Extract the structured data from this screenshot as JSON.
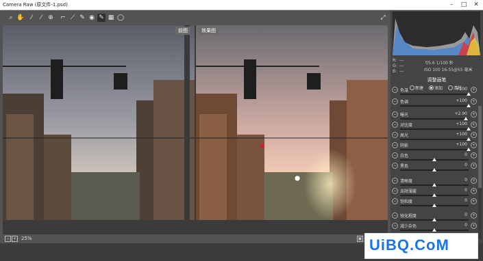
{
  "window": {
    "title": "Camera Raw (原文件-1.psd)"
  },
  "toolbar": {
    "tools": [
      "zoom-icon",
      "hand-icon",
      "white-balance-icon",
      "color-sampler-icon",
      "targeted-adjust-icon",
      "crop-icon",
      "straighten-icon",
      "spot-removal-icon",
      "red-eye-icon",
      "adjustment-brush-icon",
      "graduated-filter-icon",
      "radial-filter-icon"
    ],
    "fullscreen_icon": "fullscreen-icon"
  },
  "preview": {
    "before_label": "前图",
    "after_label": "效果图"
  },
  "bottombar": {
    "zoom": "25%"
  },
  "histogram": {
    "r_label": "R:",
    "g_label": "G:",
    "b_label": "B:",
    "r_value": "---",
    "g_value": "---",
    "b_value": "---",
    "aperture_shutter": "f/5.6   1/100 秒",
    "iso_lens": "ISO 100   16-55@55 毫米"
  },
  "panel": {
    "title": "调整画笔",
    "modes": [
      "新建",
      "添加",
      "清除"
    ],
    "active_mode": "添加",
    "sliders": [
      {
        "label": "色温",
        "value": "+100"
      },
      {
        "label": "色调",
        "value": "+100"
      },
      {
        "label": "曝光",
        "value": "+2.90"
      },
      {
        "label": "对比度",
        "value": "+100"
      },
      {
        "label": "高光",
        "value": "+100"
      },
      {
        "label": "阴影",
        "value": "+100"
      },
      {
        "label": "白色",
        "value": "0"
      },
      {
        "label": "黑色",
        "value": "0"
      },
      {
        "label": "清晰度",
        "value": "0"
      },
      {
        "label": "去除薄雾",
        "value": "0"
      },
      {
        "label": "饱和度",
        "value": "0"
      },
      {
        "label": "锐化程度",
        "value": "0"
      },
      {
        "label": "减少杂色",
        "value": "0"
      }
    ]
  },
  "watermark": {
    "text": "UiBQ.CoM"
  }
}
